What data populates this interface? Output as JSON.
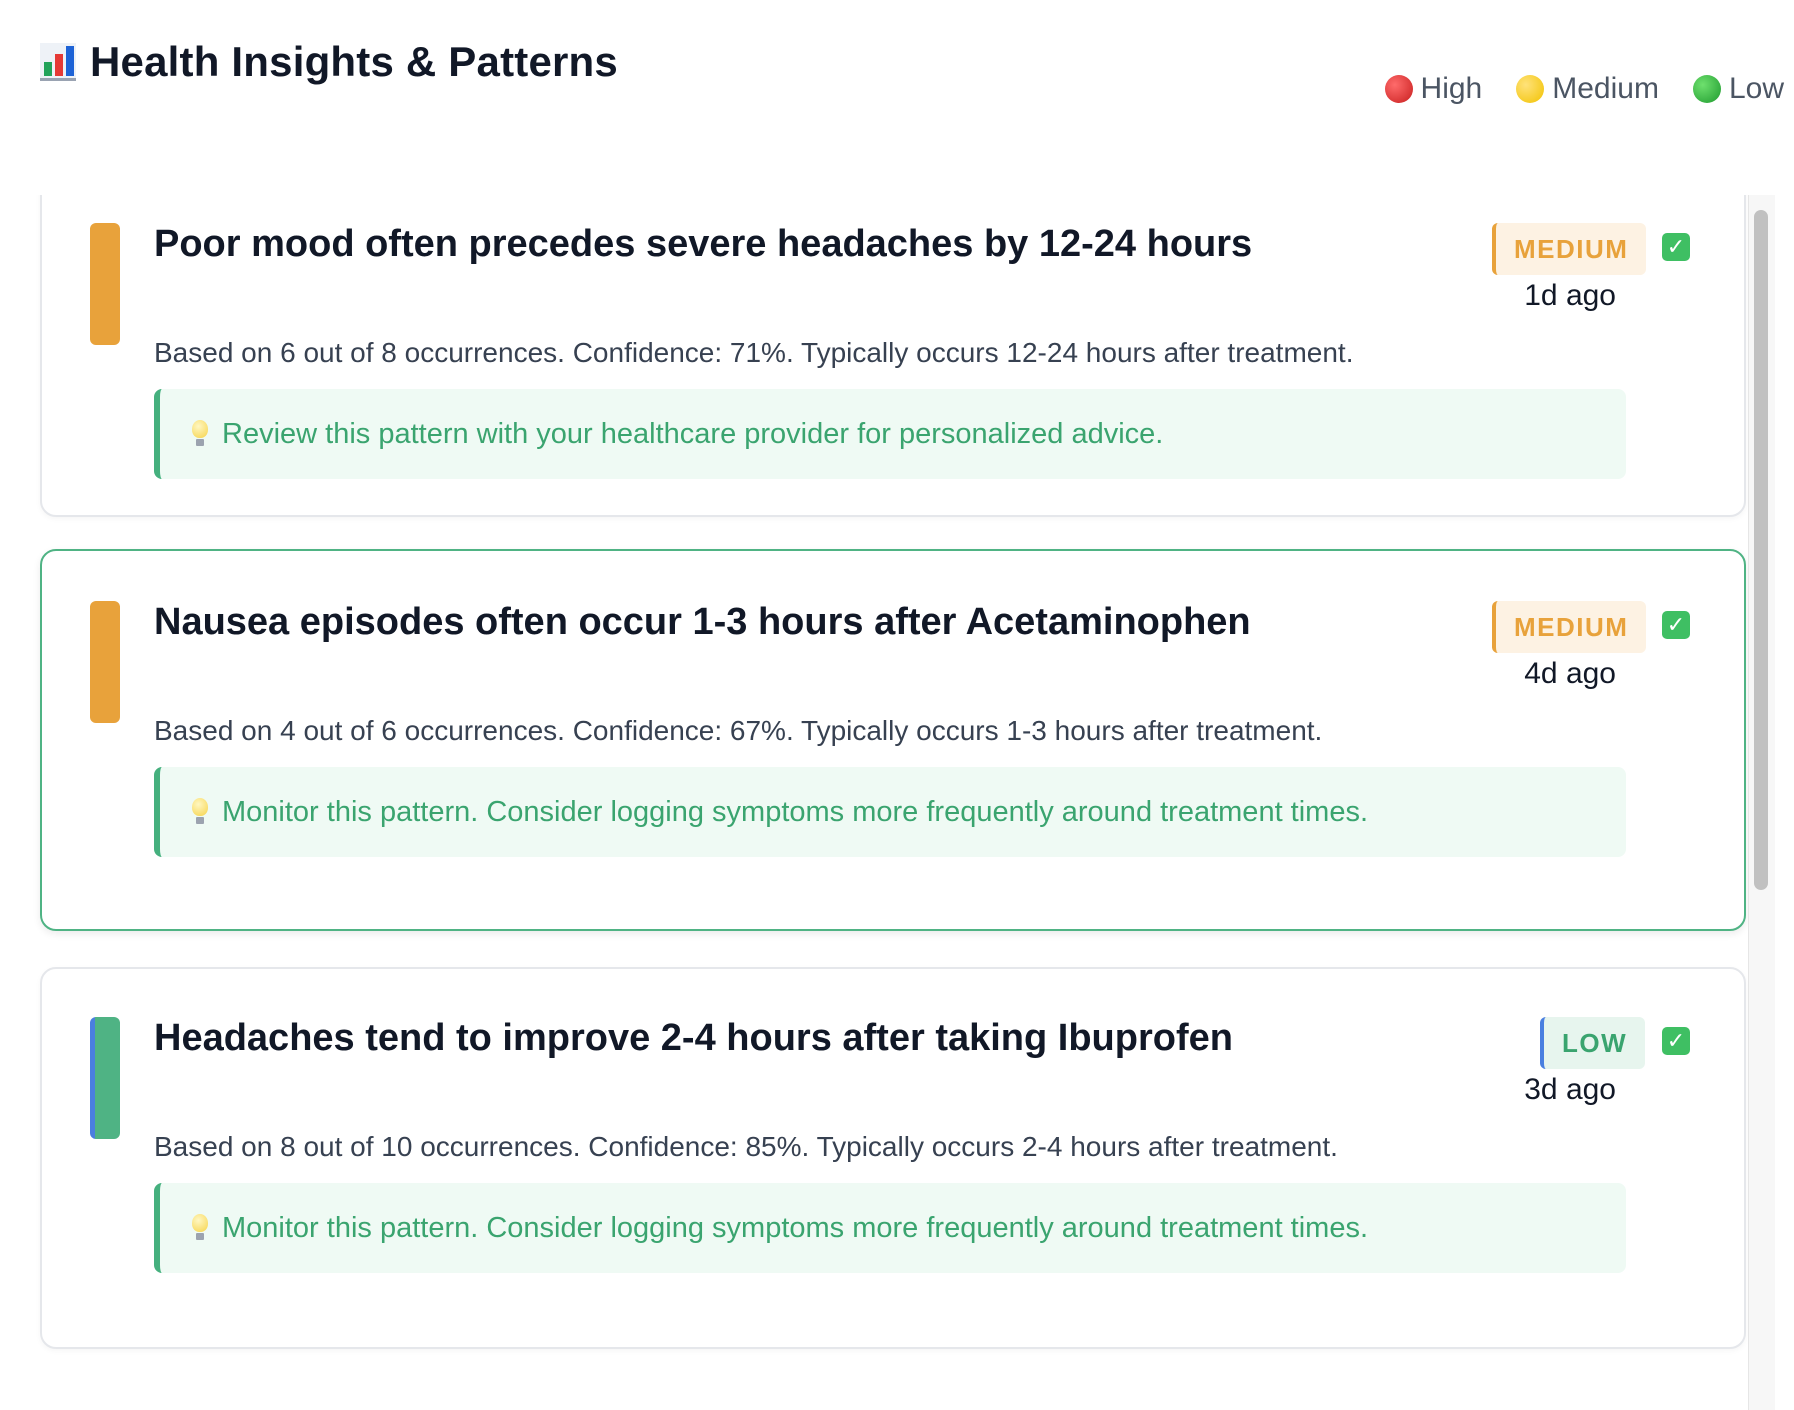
{
  "header": {
    "title": "Health Insights & Patterns",
    "icon": "bar-chart-icon"
  },
  "legend": {
    "items": [
      {
        "label": "High",
        "color": "#d32f2f"
      },
      {
        "label": "Medium",
        "color": "#f5c518"
      },
      {
        "label": "Low",
        "color": "#2ea043"
      }
    ]
  },
  "insights": [
    {
      "title": "Poor mood often precedes severe headaches by 12-24 hours",
      "priority": "MEDIUM",
      "time": "1d ago",
      "description": "Based on 6 out of 8 occurrences. Confidence: 71%. Typically occurs 12-24 hours after treatment.",
      "recommendation": "Review this pattern with your healthcare provider for personalized advice.",
      "accent_color": "#e8a23b",
      "selected": false
    },
    {
      "title": "Nausea episodes often occur 1-3 hours after Acetaminophen",
      "priority": "MEDIUM",
      "time": "4d ago",
      "description": "Based on 4 out of 6 occurrences. Confidence: 67%. Typically occurs 1-3 hours after treatment.",
      "recommendation": "Monitor this pattern. Consider logging symptoms more frequently around treatment times.",
      "accent_color": "#e8a23b",
      "selected": true
    },
    {
      "title": "Headaches tend to improve 2-4 hours after taking Ibuprofen",
      "priority": "LOW",
      "time": "3d ago",
      "description": "Based on 8 out of 10 occurrences. Confidence: 85%. Typically occurs 2-4 hours after treatment.",
      "recommendation": "Monitor this pattern. Consider logging symptoms more frequently around treatment times.",
      "accent_color": "#4fb384",
      "selected": false
    }
  ],
  "icons": {
    "check": "check-box-icon",
    "bulb": "lightbulb-icon"
  }
}
